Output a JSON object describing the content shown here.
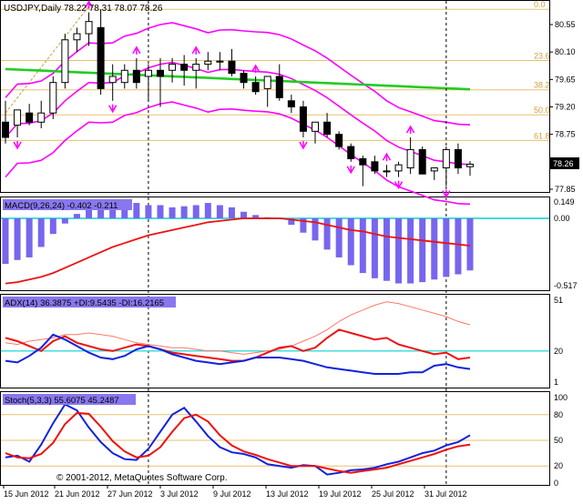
{
  "title": "USDJPY,Daily  78.22 78.31 78.07 78.26",
  "copyright": "© 2001-2012, MetaQuotes Software Corp.",
  "price": {
    "current": "78.26",
    "ticks": [
      {
        "label": "80.55",
        "value": 80.55
      },
      {
        "label": "80.10",
        "value": 80.1
      },
      {
        "label": "79.65",
        "value": 79.65
      },
      {
        "label": "79.20",
        "value": 79.2
      },
      {
        "label": "78.75",
        "value": 78.75
      },
      {
        "label": "77.85",
        "value": 77.85
      }
    ],
    "fib": [
      {
        "label": "0.0",
        "value": 80.8
      },
      {
        "label": "23.6",
        "value": 79.96
      },
      {
        "label": "38.2",
        "value": 79.48
      },
      {
        "label": "50.0",
        "value": 79.07
      },
      {
        "label": "61.8",
        "value": 78.65
      }
    ]
  },
  "macd": {
    "label": "MACD(9,26,24) -0.402 -0.211",
    "ticks": [
      {
        "label": "0.149",
        "value": 0.149
      },
      {
        "label": "0.00",
        "value": 0.0
      },
      {
        "label": "-0.517",
        "value": -0.517
      }
    ]
  },
  "adx": {
    "label": "ADX(14) 36.3875 +DI:9.5435 -DI:16.2165",
    "ticks": [
      {
        "label": "51",
        "value": 51
      },
      {
        "label": "20",
        "value": 20
      },
      {
        "label": "1",
        "value": 1
      }
    ]
  },
  "stoch": {
    "label": "Stoch(5,3,3) 55.6075 45.2487",
    "ticks": [
      {
        "label": "100",
        "value": 100
      },
      {
        "label": "80",
        "value": 80
      },
      {
        "label": "50",
        "value": 50
      },
      {
        "label": "20",
        "value": 20
      },
      {
        "label": "0",
        "value": 0
      }
    ]
  },
  "dates": [
    "15 Jun 2012",
    "21 Jun 2012",
    "27 Jun 2012",
    "3 Jul 2012",
    "9 Jul 2012",
    "13 Jul 2012",
    "19 Jul 2012",
    "25 Jul 2012",
    "31 Jul 2012"
  ],
  "colors": {
    "bull": "#ffffff",
    "bear": "#000000",
    "envelope": "#ff00ff",
    "ma": "#22cc22",
    "fib": "#e8c070",
    "macd_hist": "#7766ee",
    "macd_signal": "#ee1111",
    "zero_line": "#44dddd",
    "adx_pdi": "#ee1111",
    "adx_mdi": "#1122dd",
    "adx_main": "#ff7766",
    "stoch_k": "#1122dd",
    "stoch_d": "#ee1111"
  },
  "chart_data": {
    "type": "candlestick",
    "candles": [
      {
        "o": 78.95,
        "h": 79.3,
        "l": 78.6,
        "c": 78.7
      },
      {
        "o": 78.9,
        "h": 79.1,
        "l": 78.7,
        "c": 79.15
      },
      {
        "o": 79.1,
        "h": 79.25,
        "l": 78.9,
        "c": 78.95
      },
      {
        "o": 78.95,
        "h": 79.3,
        "l": 78.85,
        "c": 79.1
      },
      {
        "o": 79.1,
        "h": 79.7,
        "l": 79.0,
        "c": 79.6
      },
      {
        "o": 79.6,
        "h": 80.4,
        "l": 79.5,
        "c": 80.3
      },
      {
        "o": 80.3,
        "h": 80.5,
        "l": 80.1,
        "c": 80.4
      },
      {
        "o": 80.4,
        "h": 80.75,
        "l": 80.2,
        "c": 80.6
      },
      {
        "o": 80.5,
        "h": 80.8,
        "l": 79.4,
        "c": 79.5
      },
      {
        "o": 79.6,
        "h": 79.9,
        "l": 79.3,
        "c": 79.7
      },
      {
        "o": 79.6,
        "h": 79.9,
        "l": 79.5,
        "c": 79.8
      },
      {
        "o": 79.8,
        "h": 80.0,
        "l": 79.5,
        "c": 79.6
      },
      {
        "o": 79.7,
        "h": 79.9,
        "l": 79.3,
        "c": 79.8
      },
      {
        "o": 79.8,
        "h": 80.0,
        "l": 79.2,
        "c": 79.7
      },
      {
        "o": 79.8,
        "h": 80.0,
        "l": 79.6,
        "c": 79.9
      },
      {
        "o": 79.9,
        "h": 80.05,
        "l": 79.55,
        "c": 79.8
      },
      {
        "o": 79.8,
        "h": 80.0,
        "l": 79.5,
        "c": 79.9
      },
      {
        "o": 79.9,
        "h": 80.1,
        "l": 79.8,
        "c": 79.95
      },
      {
        "o": 79.95,
        "h": 80.1,
        "l": 79.8,
        "c": 79.95
      },
      {
        "o": 79.95,
        "h": 80.15,
        "l": 79.7,
        "c": 79.75
      },
      {
        "o": 79.75,
        "h": 79.8,
        "l": 79.5,
        "c": 79.6
      },
      {
        "o": 79.6,
        "h": 79.7,
        "l": 79.4,
        "c": 79.45
      },
      {
        "o": 79.5,
        "h": 79.7,
        "l": 79.2,
        "c": 79.7
      },
      {
        "o": 79.7,
        "h": 79.9,
        "l": 79.3,
        "c": 79.35
      },
      {
        "o": 79.3,
        "h": 79.4,
        "l": 79.1,
        "c": 79.2
      },
      {
        "o": 79.2,
        "h": 79.3,
        "l": 78.7,
        "c": 78.8
      },
      {
        "o": 78.8,
        "h": 78.95,
        "l": 78.6,
        "c": 78.95
      },
      {
        "o": 78.95,
        "h": 79.1,
        "l": 78.7,
        "c": 78.75
      },
      {
        "o": 78.75,
        "h": 78.8,
        "l": 78.5,
        "c": 78.55
      },
      {
        "o": 78.55,
        "h": 78.6,
        "l": 78.3,
        "c": 78.35
      },
      {
        "o": 78.35,
        "h": 78.4,
        "l": 77.9,
        "c": 78.25
      },
      {
        "o": 78.3,
        "h": 78.4,
        "l": 78.1,
        "c": 78.15
      },
      {
        "o": 78.15,
        "h": 78.25,
        "l": 78.05,
        "c": 78.15
      },
      {
        "o": 78.15,
        "h": 78.3,
        "l": 78.05,
        "c": 78.25
      },
      {
        "o": 78.2,
        "h": 78.7,
        "l": 78.1,
        "c": 78.5
      },
      {
        "o": 78.5,
        "h": 78.55,
        "l": 78.1,
        "c": 78.1
      },
      {
        "o": 78.15,
        "h": 78.2,
        "l": 78.0,
        "c": 78.2
      },
      {
        "o": 78.2,
        "h": 78.55,
        "l": 77.9,
        "c": 78.5
      },
      {
        "o": 78.5,
        "h": 78.6,
        "l": 78.1,
        "c": 78.2
      },
      {
        "o": 78.22,
        "h": 78.31,
        "l": 78.07,
        "c": 78.26
      }
    ],
    "macd_hist": [
      -0.35,
      -0.32,
      -0.3,
      -0.22,
      -0.12,
      -0.04,
      0.04,
      0.1,
      0.12,
      0.13,
      0.13,
      0.14,
      0.12,
      0.12,
      0.1,
      0.11,
      0.12,
      0.14,
      0.12,
      0.1,
      0.06,
      0.03,
      0.01,
      0.0,
      -0.05,
      -0.11,
      -0.17,
      -0.24,
      -0.3,
      -0.36,
      -0.42,
      -0.46,
      -0.48,
      -0.5,
      -0.5,
      -0.49,
      -0.47,
      -0.45,
      -0.43,
      -0.4
    ],
    "macd_signal": [
      -0.5,
      -0.49,
      -0.47,
      -0.45,
      -0.42,
      -0.38,
      -0.34,
      -0.3,
      -0.26,
      -0.22,
      -0.19,
      -0.16,
      -0.13,
      -0.11,
      -0.09,
      -0.07,
      -0.05,
      -0.03,
      -0.02,
      -0.01,
      0.0,
      0.0,
      0.0,
      0.0,
      -0.01,
      -0.02,
      -0.03,
      -0.05,
      -0.07,
      -0.09,
      -0.1,
      -0.12,
      -0.14,
      -0.15,
      -0.16,
      -0.17,
      -0.18,
      -0.19,
      -0.2,
      -0.21
    ],
    "adx_main": [
      25,
      24,
      26,
      27,
      28,
      30,
      30,
      31,
      30,
      29,
      27,
      25,
      24,
      23,
      22,
      22,
      21,
      20,
      20,
      19,
      18,
      19,
      20,
      21,
      23,
      26,
      29,
      33,
      38,
      42,
      45,
      48,
      50,
      49,
      47,
      45,
      43,
      41,
      38,
      36
    ],
    "adx_pdi": [
      28,
      26,
      23,
      20,
      26,
      29,
      25,
      23,
      21,
      20,
      22,
      24,
      23,
      21,
      19,
      18,
      17,
      16,
      15,
      14,
      14,
      16,
      19,
      22,
      23,
      20,
      22,
      28,
      33,
      31,
      29,
      27,
      28,
      24,
      22,
      20,
      18,
      19,
      15,
      16
    ],
    "adx_mdi": [
      14,
      13,
      17,
      22,
      30,
      27,
      23,
      19,
      16,
      15,
      17,
      21,
      23,
      21,
      18,
      16,
      14,
      13,
      12,
      13,
      14,
      16,
      16,
      16,
      15,
      14,
      12,
      10,
      9,
      8,
      7,
      6,
      6,
      6,
      7,
      7,
      11,
      12,
      10,
      9
    ],
    "stoch_k": [
      30,
      32,
      25,
      45,
      70,
      92,
      85,
      65,
      48,
      35,
      28,
      27,
      40,
      60,
      80,
      88,
      72,
      55,
      42,
      36,
      34,
      30,
      22,
      20,
      18,
      21,
      20,
      10,
      12,
      15,
      16,
      18,
      22,
      25,
      30,
      35,
      38,
      44,
      48,
      56
    ],
    "stoch_d": [
      35,
      30,
      29,
      34,
      47,
      69,
      82,
      81,
      66,
      49,
      37,
      30,
      32,
      42,
      60,
      76,
      80,
      72,
      56,
      44,
      37,
      33,
      28,
      24,
      20,
      20,
      20,
      17,
      14,
      12,
      14,
      16,
      18,
      22,
      26,
      30,
      34,
      39,
      43,
      45
    ]
  }
}
